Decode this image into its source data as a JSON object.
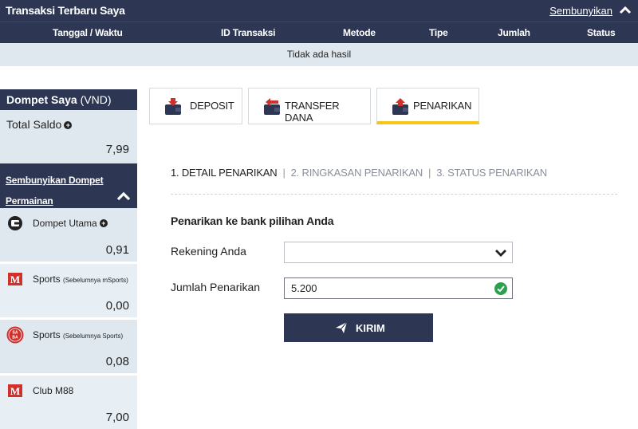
{
  "transactions": {
    "title": "Transaksi Terbaru Saya",
    "hide_label": "Sembunyikan",
    "columns": [
      "Tanggal / Waktu",
      "ID Transaksi",
      "Metode",
      "Tipe",
      "Jumlah",
      "Status"
    ],
    "empty_text": "Tidak ada hasil"
  },
  "wallet": {
    "title": "Dompet Saya",
    "currency": "(VND)",
    "total_label": "Total Saldo",
    "total_value": "7,99",
    "toggle_label": "Sembunyikan Dompet Permainan",
    "items": [
      {
        "name": "Dompet Utama",
        "sub": "",
        "value": "0,91",
        "icon": "wallet-icon"
      },
      {
        "name": "Sports",
        "sub": "(Sebelumnya mSports)",
        "value": "0,00",
        "icon": "m88-logo-icon"
      },
      {
        "name": "Sports",
        "sub": "(Sebelumnya Sports)",
        "value": "0,08",
        "icon": "saba-logo-icon"
      },
      {
        "name": "Club M88",
        "sub": "",
        "value": "7,00",
        "icon": "m88-logo-icon"
      }
    ]
  },
  "tabs": [
    {
      "label": "DEPOSIT",
      "icon": "deposit-wallet-icon"
    },
    {
      "label": "TRANSFER DANA",
      "icon": "transfer-wallet-icon"
    },
    {
      "label": "PENARIKAN",
      "icon": "withdraw-wallet-icon",
      "active": true
    }
  ],
  "withdrawal": {
    "steps": [
      "1. DETAIL PENARIKAN",
      "2. RINGKASAN PENARIKAN",
      "3. STATUS PENARIKAN"
    ],
    "separator": "|",
    "section_title": "Penarikan ke bank pilihan Anda",
    "account_label": "Rekening Anda",
    "account_value": "",
    "amount_label": "Jumlah Penarikan",
    "amount_value": "5.200",
    "submit_label": "KIRIM"
  },
  "colors": {
    "navy": "#2d3753",
    "light_panel": "#dfe8ef",
    "accent_yellow": "#f5c518",
    "icon_red": "#d0312d",
    "success_green": "#2e9e4f"
  }
}
